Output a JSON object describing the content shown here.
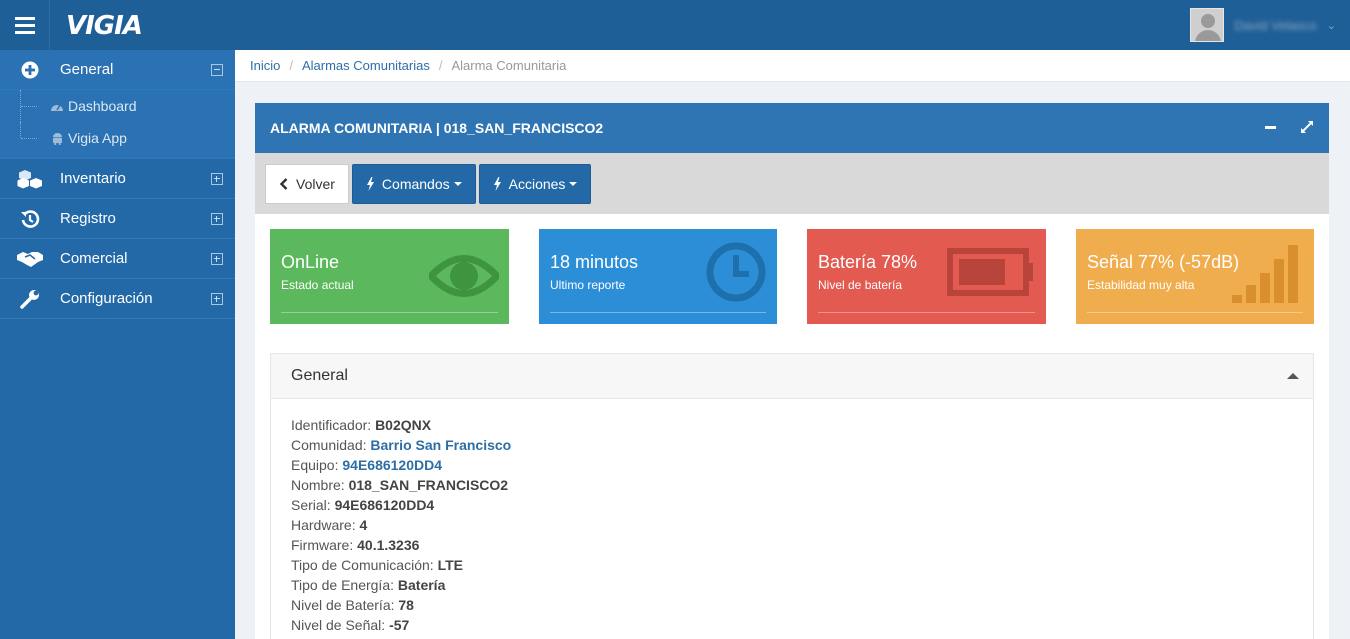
{
  "app": {
    "logo": "VIGIA",
    "user_name": "David Velasco"
  },
  "sidebar": {
    "items": [
      {
        "label": "General",
        "icon": "plus-circle-icon",
        "expanded": true,
        "children": [
          {
            "label": "Dashboard",
            "icon": "dashboard-icon"
          },
          {
            "label": "Vigia App",
            "icon": "android-icon"
          }
        ]
      },
      {
        "label": "Inventario",
        "icon": "cubes-icon"
      },
      {
        "label": "Registro",
        "icon": "history-icon"
      },
      {
        "label": "Comercial",
        "icon": "handshake-icon"
      },
      {
        "label": "Configuración",
        "icon": "wrench-icon"
      }
    ]
  },
  "breadcrumb": {
    "items": [
      "Inicio",
      "Alarmas Comunitarias"
    ],
    "current": "Alarma Comunitaria"
  },
  "panel": {
    "title": "ALARMA COMUNITARIA | 018_SAN_FRANCISCO2",
    "buttons": {
      "back": "Volver",
      "commands": "Comandos",
      "actions": "Acciones"
    }
  },
  "tiles": [
    {
      "title": "OnLine",
      "subtitle": "Estado actual",
      "color": "#5cb85c",
      "icon": "eye-icon"
    },
    {
      "title": "18 minutos",
      "subtitle": "Ultimo reporte",
      "color": "#2d8ed8",
      "icon": "clock-icon"
    },
    {
      "title": "Batería 78%",
      "subtitle": "Nivel de batería",
      "color": "#e35a50",
      "icon": "battery-icon"
    },
    {
      "title": "Señal 77% (-57dB)",
      "subtitle": "Estabilidad muy alta",
      "color": "#f0ad4e",
      "icon": "signal-icon"
    }
  ],
  "general": {
    "title": "General",
    "fields": [
      {
        "label": "Identificador:",
        "value": "B02QNX"
      },
      {
        "label": "Comunidad:",
        "value": "Barrio San Francisco",
        "link": true
      },
      {
        "label": "Equipo:",
        "value": "94E686120DD4",
        "link": true
      },
      {
        "label": "Nombre:",
        "value": "018_SAN_FRANCISCO2"
      },
      {
        "label": "Serial:",
        "value": "94E686120DD4"
      },
      {
        "label": "Hardware:",
        "value": "4"
      },
      {
        "label": "Firmware:",
        "value": "40.1.3236"
      },
      {
        "label": "Tipo de Comunicación:",
        "value": "LTE"
      },
      {
        "label": "Tipo de Energía:",
        "value": "Batería"
      },
      {
        "label": "Nivel de Batería:",
        "value": "78"
      },
      {
        "label": "Nivel de Señal:",
        "value": "-57"
      }
    ]
  }
}
